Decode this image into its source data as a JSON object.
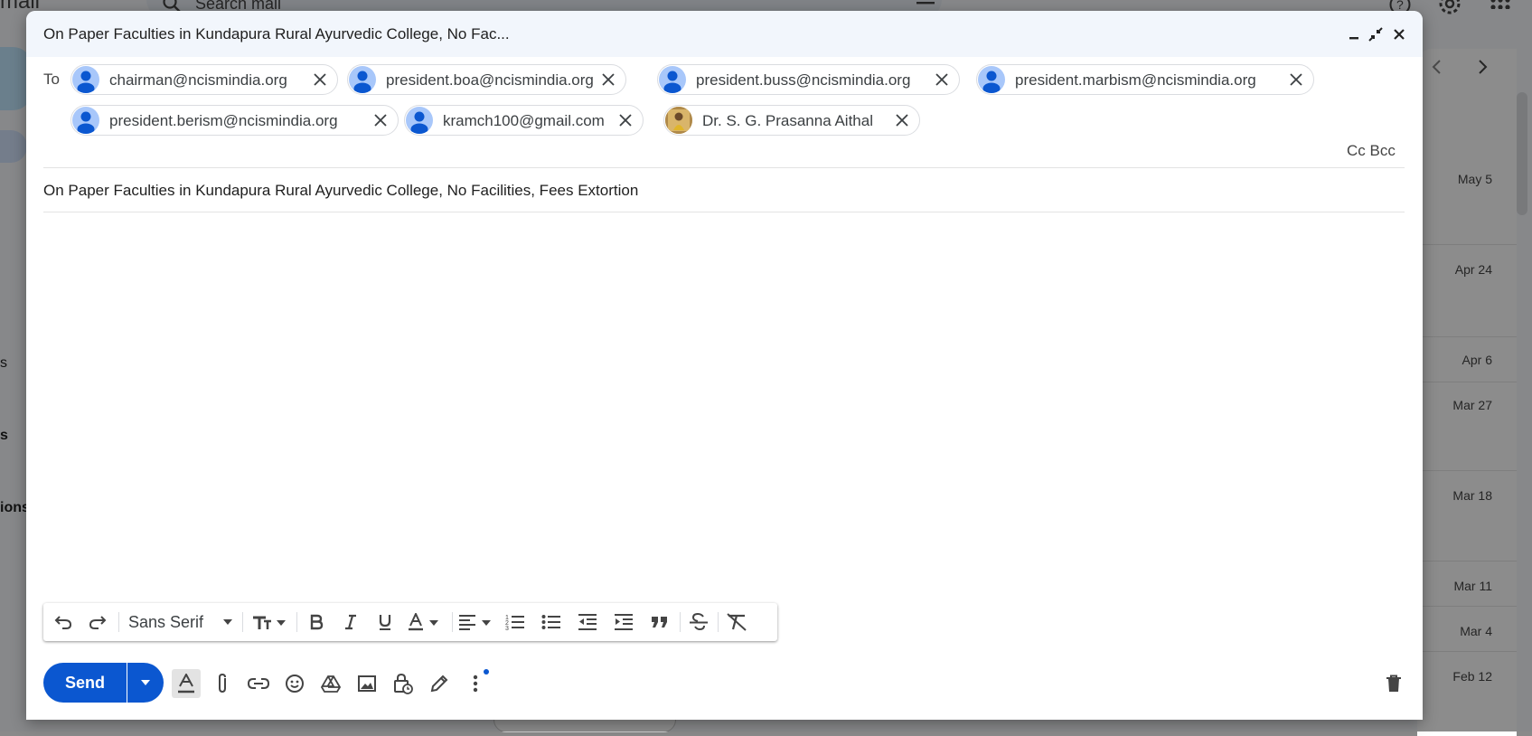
{
  "background": {
    "brand_fragment": "mail",
    "search_placeholder": "Search mail",
    "nav_fragments": [
      "s",
      "s",
      "ions"
    ],
    "mail_dates": [
      "May 5",
      "Apr 24",
      "Apr 6",
      "Mar 27",
      "Mar 18",
      "Mar 11",
      "Mar 4",
      "Feb 12"
    ]
  },
  "compose": {
    "title": "On Paper Faculties in Kundapura Rural Ayurvedic College, No Fac...",
    "to_label": "To",
    "recipients": [
      {
        "email": "chairman@ncismindia.org",
        "avatar": "person-icon"
      },
      {
        "email": "president.boa@ncismindia.org",
        "avatar": "person-icon"
      },
      {
        "email": "president.buss@ncismindia.org",
        "avatar": "person-icon"
      },
      {
        "email": "president.marbism@ncismindia.org",
        "avatar": "person-icon"
      },
      {
        "email": "president.berism@ncismindia.org",
        "avatar": "person-icon"
      },
      {
        "email": "kramch100@gmail.com",
        "avatar": "person-icon"
      },
      {
        "email": "Dr. S. G. Prasanna Aithal",
        "avatar": "photo-avatar"
      }
    ],
    "cc_label": "Cc",
    "bcc_label": "Bcc",
    "subject": "On Paper Faculties in Kundapura Rural Ayurvedic College, No Facilities, Fees Extortion",
    "body": "",
    "font_name": "Sans Serif",
    "send_label": "Send",
    "colors": {
      "primary": "#0b57d0",
      "header_bg": "#f2f6fc",
      "avatar": "#a8c7fa"
    }
  }
}
